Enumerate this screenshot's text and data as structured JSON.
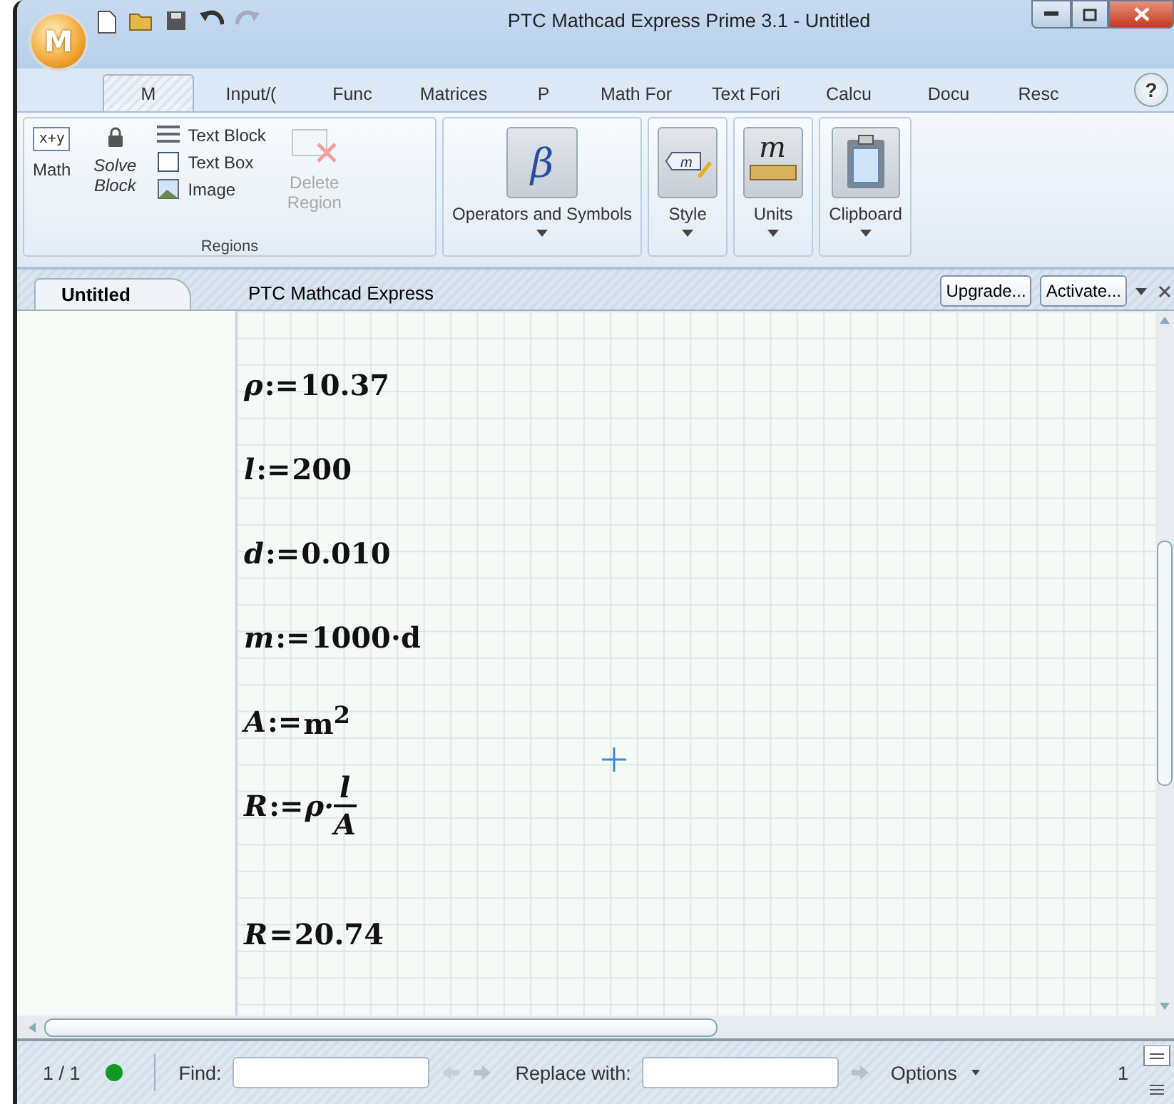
{
  "window": {
    "title": "PTC Mathcad Express Prime 3.1 - Untitled",
    "logo": "M"
  },
  "ribbon_tabs": [
    {
      "label": "M",
      "selected": true
    },
    {
      "label": "Input/(",
      "selected": false
    },
    {
      "label": "Func",
      "selected": false
    },
    {
      "label": "Matrices",
      "selected": false
    },
    {
      "label": "P",
      "selected": false
    },
    {
      "label": "Math For",
      "selected": false
    },
    {
      "label": "Text Fori",
      "selected": false
    },
    {
      "label": "Calcu",
      "selected": false
    },
    {
      "label": "Docu",
      "selected": false
    },
    {
      "label": "Resc",
      "selected": false
    }
  ],
  "help": "?",
  "regions_group": {
    "title": "Regions",
    "math": {
      "label": "Math",
      "icon_text": "x+y"
    },
    "solve_block": "Solve Block",
    "items": [
      "Text Block",
      "Text Box",
      "Image"
    ],
    "delete": {
      "label": "Delete Region",
      "disabled": true
    }
  },
  "groups": [
    {
      "kind": "operators",
      "label": "Operators and Symbols",
      "glyph": "β"
    },
    {
      "kind": "style",
      "label": "Style",
      "glyph": "m"
    },
    {
      "kind": "units",
      "label": "Units",
      "glyph": "m"
    },
    {
      "kind": "clipboard",
      "label": "Clipboard"
    }
  ],
  "document_tabs": [
    {
      "label": "Untitled",
      "selected": true
    }
  ],
  "document_caption": "PTC Mathcad Express",
  "doc_buttons": [
    "Upgrade...",
    "Activate..."
  ],
  "equations": [
    {
      "kind": "define",
      "lhs": "ρ",
      "operator": ":=",
      "rhs": "10.37"
    },
    {
      "kind": "define",
      "lhs": "l",
      "operator": ":=",
      "rhs": "200"
    },
    {
      "kind": "define",
      "lhs": "d",
      "operator": ":=",
      "rhs": "0.010"
    },
    {
      "kind": "define",
      "lhs": "m",
      "operator": ":=",
      "rhs": "1000·d"
    },
    {
      "kind": "define",
      "lhs": "A",
      "operator": ":=",
      "rhs": "m$^{2}$"
    },
    {
      "kind": "fraction",
      "lhs": "R",
      "operator": ":=",
      "factor": "ρ·",
      "numerator": "l",
      "denominator": "A"
    },
    {
      "kind": "evaluate",
      "lhs": "R",
      "operator": "=",
      "rhs": "20.74"
    }
  ],
  "status_bar": {
    "page": "1 / 1",
    "status_dot": {
      "color": "#119a22"
    },
    "find_label": "Find:",
    "replace_label": "Replace with:",
    "options": "Options",
    "zoom": "1"
  }
}
